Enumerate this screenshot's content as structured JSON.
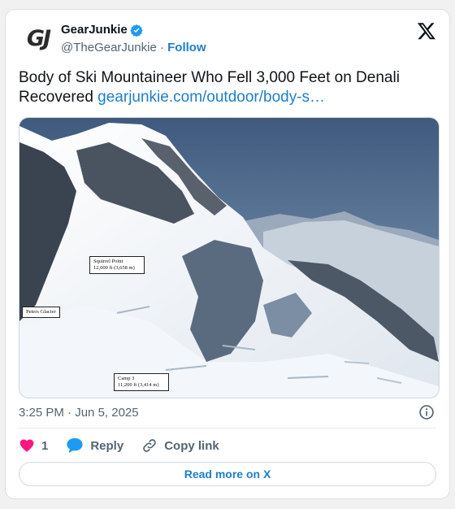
{
  "account": {
    "logo_text": "GJ",
    "display_name": "GearJunkie",
    "handle": "@TheGearJunkie",
    "separator": "·",
    "follow_label": "Follow"
  },
  "tweet": {
    "text": "Body of Ski Mountaineer Who Fell 3,000 Feet on Denali Recovered",
    "link": "gearjunkie.com/outdoor/body-s…"
  },
  "media": {
    "labels": {
      "squirrel_point_name": "Squirrel Point",
      "squirrel_point_elev": "12,000 ft (3,658 m)",
      "peters_glacier": "Peters Glacier",
      "camp_name": "Camp 3",
      "camp_elev": "11,200 ft (3,414 m)"
    }
  },
  "meta": {
    "time": "3:25 PM",
    "separator": "·",
    "date": "Jun 5, 2025"
  },
  "actions": {
    "like_count": "1",
    "reply_label": "Reply",
    "copy_link_label": "Copy link"
  },
  "read_more_label": "Read more on X",
  "colors": {
    "link_blue": "#1d7fc7",
    "like_pink": "#f91880",
    "verified_blue": "#1d9bf0",
    "reply_blue": "#1d9bf0"
  },
  "icons": [
    "verified-badge-icon",
    "x-logo-icon",
    "info-icon",
    "heart-icon",
    "reply-bubble-icon",
    "link-icon"
  ]
}
